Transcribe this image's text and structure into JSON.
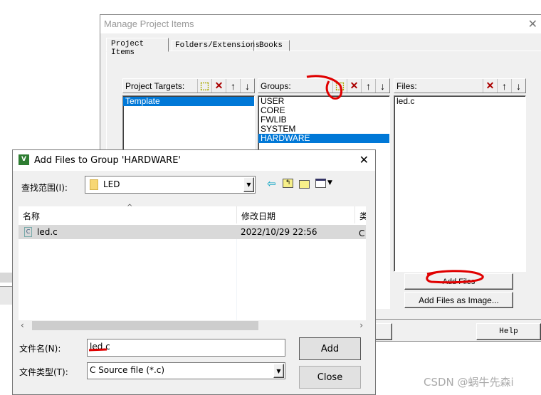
{
  "back_dialog": {
    "title": "Manage Project Items",
    "tabs": [
      {
        "label": "Project Items",
        "active": true
      },
      {
        "label": "Folders/Extensions"
      },
      {
        "label": "Books"
      }
    ],
    "targets": {
      "header": "Project Targets:",
      "items": [
        "Template"
      ],
      "selected": "Template"
    },
    "groups": {
      "header": "Groups:",
      "items": [
        "USER",
        "CORE",
        "FWLIB",
        "SYSTEM",
        "HARDWARE"
      ],
      "selected": "HARDWARE"
    },
    "files": {
      "header": "Files:",
      "items": [
        "led.c"
      ]
    },
    "add_files": "Add Files",
    "add_files_image": "Add Files as Image...",
    "help": "Help"
  },
  "front_dialog": {
    "title": "Add Files to Group 'HARDWARE'",
    "look_in_label": "查找范围(I):",
    "look_in_value": "LED",
    "columns": [
      "名称",
      "修改日期",
      "类型"
    ],
    "rows": [
      {
        "name": "led.c",
        "date": "2022/10/29 22:56",
        "type": "C 源"
      }
    ],
    "filename_label": "文件名(N):",
    "filename_value": "led.c",
    "filetype_label": "文件类型(T):",
    "filetype_value": "C Source file (*.c)",
    "add": "Add",
    "close": "Close"
  },
  "watermark": "CSDN @蜗牛先森i",
  "colors": {
    "selection": "#0078d7",
    "annotation": "#e00000"
  }
}
